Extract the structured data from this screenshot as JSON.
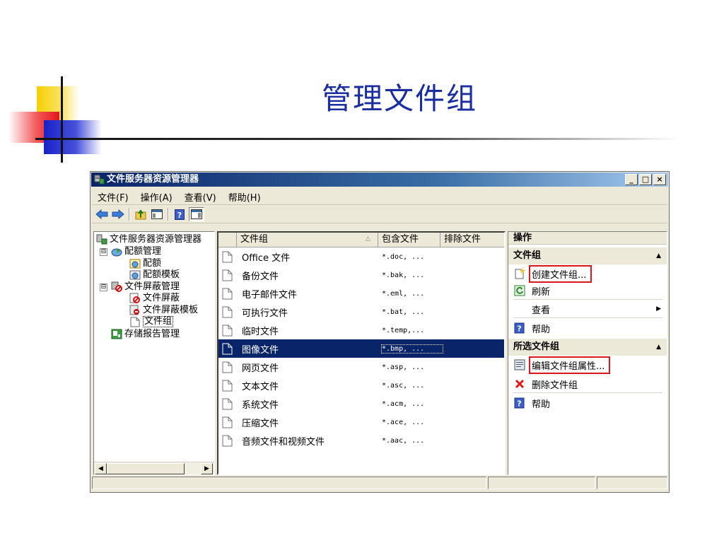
{
  "slide": {
    "title": "管理文件组"
  },
  "window": {
    "title": "文件服务器资源管理器",
    "controls": {
      "minimize": "_",
      "maximize": "□",
      "close": "×"
    }
  },
  "menu": [
    {
      "label": "文件(F)"
    },
    {
      "label": "操作(A)"
    },
    {
      "label": "查看(V)"
    },
    {
      "label": "帮助(H)"
    }
  ],
  "toolbar": [
    {
      "icon": "back-arrow-icon"
    },
    {
      "icon": "forward-arrow-icon"
    },
    {
      "icon": "up-folder-icon"
    },
    {
      "icon": "console-tree-icon"
    },
    {
      "icon": "help-icon"
    },
    {
      "icon": "action-pane-icon"
    }
  ],
  "tree": {
    "root": "文件服务器资源管理器",
    "quota": {
      "label": "配额管理",
      "children": [
        "配额",
        "配额模板"
      ]
    },
    "screen": {
      "label": "文件屏蔽管理",
      "children": [
        "文件屏蔽",
        "文件屏蔽模板",
        "文件组"
      ]
    },
    "reports": "存储报告管理",
    "selected": "文件组",
    "expanded_glyph": "⊟"
  },
  "list": {
    "columns": [
      "文件组",
      "包含文件",
      "排除文件"
    ],
    "sort_glyph": "△",
    "rows": [
      {
        "name": "Office 文件",
        "include": "*.doc, ..."
      },
      {
        "name": "备份文件",
        "include": "*.bak, ..."
      },
      {
        "name": "电子邮件文件",
        "include": "*.eml, ..."
      },
      {
        "name": "可执行文件",
        "include": "*.bat, ..."
      },
      {
        "name": "临时文件",
        "include": "*.temp,..."
      },
      {
        "name": "图像文件",
        "include": "*.bmp, ...",
        "selected": true
      },
      {
        "name": "网页文件",
        "include": "*.asp, ..."
      },
      {
        "name": "文本文件",
        "include": "*.asc, ..."
      },
      {
        "name": "系统文件",
        "include": "*.acm, ..."
      },
      {
        "name": "压缩文件",
        "include": "*.ace, ..."
      },
      {
        "name": "音频文件和视频文件",
        "include": "*.aac, ..."
      }
    ]
  },
  "actions": {
    "title": "操作",
    "section1": {
      "title": "文件组",
      "items": {
        "create": "创建文件组...",
        "refresh": "刷新",
        "view": "查看",
        "help": "帮助"
      }
    },
    "section2": {
      "title": "所选文件组",
      "items": {
        "edit": "编辑文件组属性...",
        "delete": "删除文件组",
        "help": "帮助"
      }
    },
    "collapse_glyph": "▲",
    "submenu_glyph": "▶"
  },
  "scrollbar": {
    "left_glyph": "◀",
    "right_glyph": "▶"
  },
  "colors": {
    "title_blue": "#1a2ea0",
    "selection": "#0a246a",
    "highlight_box": "#e0161c"
  }
}
